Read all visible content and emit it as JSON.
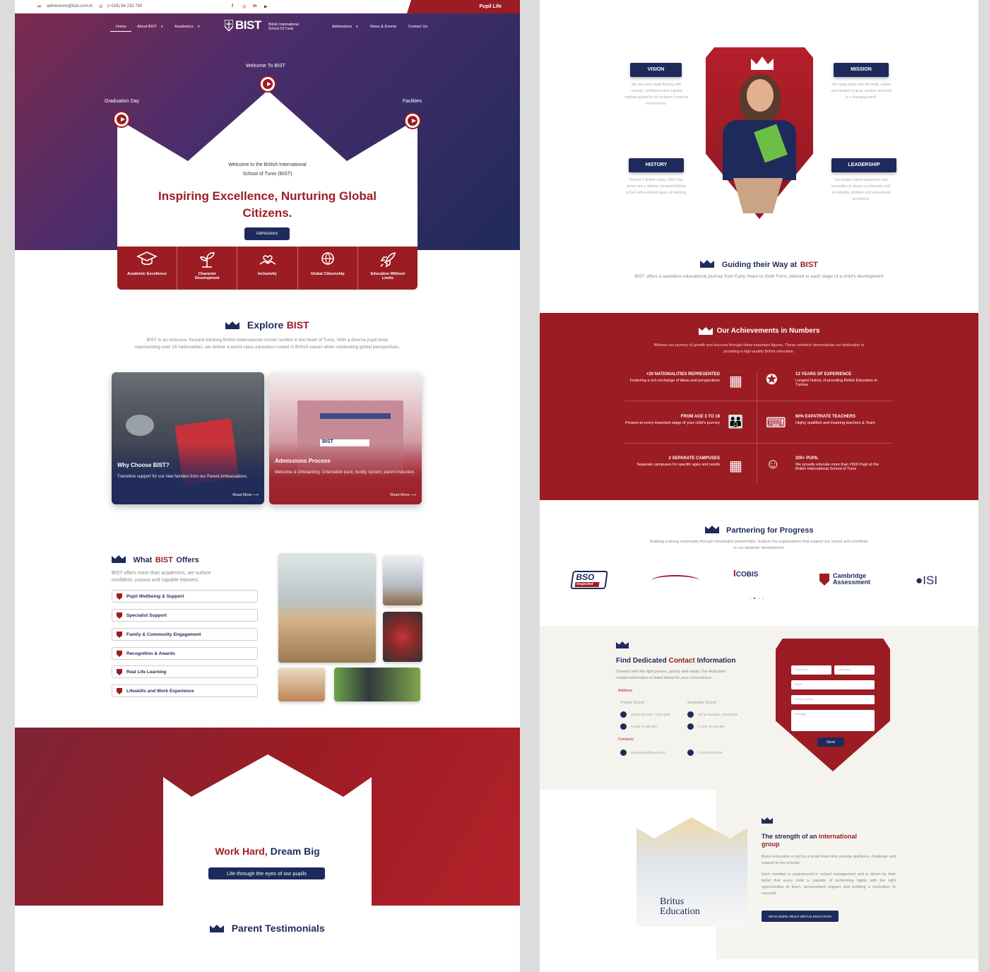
{
  "topbar": {
    "email": "admissions@bist.com.tn",
    "phone": "(+216) 94 232 730",
    "pupil_life": "Pupil Life"
  },
  "nav": {
    "home": "Home",
    "about": "About BIST",
    "academics": "Academics",
    "admissions": "Admissions",
    "news": "News & Events",
    "contact": "Contact Us"
  },
  "logo": {
    "name": "BIST",
    "line1": "British International",
    "line2": "School Of Tunis"
  },
  "hero": {
    "label_center": "Welcome To BIST",
    "label_left": "Graduation Day",
    "label_right": "Facilities",
    "welcome1": "Welcome to the British International",
    "welcome2": "School of Tunis (BIST)",
    "headline1": "Inspiring Excellence, Nurturing Global",
    "headline2": "Citizens.",
    "cta": "Admissions"
  },
  "features": [
    {
      "l1": "Academic Excellence",
      "l2": ""
    },
    {
      "l1": "Character",
      "l2": "Development"
    },
    {
      "l1": "Inclusivity",
      "l2": ""
    },
    {
      "l1": "Global Citizenship",
      "l2": ""
    },
    {
      "l1": "Education Without",
      "l2": "Limits"
    }
  ],
  "explore": {
    "title_a": "Explore",
    "title_b": "BIST",
    "p1": "BIST is an inclusive, forward-thinking British international school nestled in the heart of Tunis. With a diverse pupil body",
    "p2": "representing over 19 nationalities, we deliver a world-class education rooted in British values while celebrating global perspectives."
  },
  "cards": [
    {
      "title": "Why Choose BIST?",
      "desc": "Transition support for our new families from our Parent Ambassadors.",
      "more": "Read More"
    },
    {
      "title": "Admissions Process",
      "desc": "Welcome & Onboarding: Orientation pack, buddy system, parent induction.",
      "more": "Read More"
    }
  ],
  "offers": {
    "title_a": "What",
    "title_b": "BIST",
    "title_c": "Offers",
    "p1": "BIST offers more than academics, we nurture",
    "p2": "confident, curious and capable learners.",
    "items": [
      "Pupil Wellbeing & Support",
      "Specialist Support",
      "Family & Community Engagement",
      "Recognition & Awards",
      "Real Life Learning",
      "Lifeskills and Work Experience"
    ]
  },
  "banner": {
    "title_a": "Work Hard,",
    "title_b": "Dream Big",
    "button": "Life through the eyes of our pupils"
  },
  "testimonials": {
    "title": "Parent Testimonials"
  },
  "values": {
    "vision": {
      "label": "VISION",
      "text": "We see every pupil thriving with curiosity, confidence and a global mindset guided by an inclusive, inspiring environment."
    },
    "mission": {
      "label": "MISSION",
      "text": "We equip pupils with the skills, values and mindset to grow, achieve and lead in a changing world."
    },
    "history": {
      "label": "HISTORY",
      "text": "Rooted in British values, BIST has grown into a diverse, forward-thinking school with a strong legacy of learning."
    },
    "leadership": {
      "label": "LEADERSHIP",
      "text": "Our leaders blend experience and innovation to shape a community built on integrity, ambition and educational excellence."
    }
  },
  "guiding": {
    "title_a": "Guiding their Way at",
    "title_b": "BIST",
    "text": "BIST offers a seamless educational journey from Early Years to Sixth Form, tailored to each stage of a child's development"
  },
  "achievements": {
    "title": "Our Achievements in Numbers",
    "p1": "Witness our journey of growth and success through these important figures. These numbers demonstrate our dedication to",
    "p2": "providing a high-quality British education.",
    "items": [
      {
        "head": "+20 NATIONALITIES REPRESENTED",
        "text": "Fostering a rich exchange of ideas and perspectives"
      },
      {
        "head": "13 YEARS OF EXPERIENCE",
        "text": "Longest history of providing British Education in Tunisia"
      },
      {
        "head": "FROM AGE 3 TO 18",
        "text": "Present at every important stage of your child's journey"
      },
      {
        "head": "60% EXPATRIATE TEACHERS",
        "text": "Highly qualified and inspiring teachers & Team"
      },
      {
        "head": "2 SEPARATE CAMPUSES",
        "text": "Separate campuses for specific ages and needs"
      },
      {
        "head": "200+ PUPIL",
        "text": "We proudly educate more than 2500 Pupil at the British International School of Tunis"
      }
    ]
  },
  "partners": {
    "title": "Partnering for Progress",
    "p1": "Building a strong community through meaningful partnerships. Explore the organizations that support our school and contribute",
    "p2": "to our students' development.",
    "logos": [
      "BSO",
      "Inspected",
      "COBIS",
      "Cambridge",
      "Assessment",
      "ISI"
    ]
  },
  "contact": {
    "title_a": "Find Dedicated",
    "title_b": "Contact",
    "title_c": "Information",
    "p1": "Connect with the right person, quickly and easily. Our dedicated",
    "p2": "contact information is listed below for your convenience.",
    "address_label": "Address",
    "primary": "Primary School",
    "secondary": "Secondary School",
    "addr1": "48 Rue du Parc, Tunis 2035",
    "addr2": "42 rue Socrates, 2015 Kram",
    "tel1": "(+216) 70 240 680",
    "tel2": "(+216) 70 240 680",
    "contacts_label": "Contacts",
    "email": "admissions@bist.com.tn",
    "mobile": "(+216) 94232730",
    "form": {
      "first": "First name",
      "last": "Last name",
      "email": "Email",
      "phone": "Phone number",
      "message": "Message",
      "send": "Send"
    }
  },
  "britus": {
    "title_a": "The strength of an",
    "title_b": "international",
    "title_c": "group",
    "p1": "Britus Education is led by a small team who provide guidance, challenge and support to the schools.",
    "p2": "Each member is experienced in school management and is driven by their belief that every child is capable of performing highly with the right opportunities to learn, personalised support and instilling a motivation to succeed.",
    "button": "READ MORE ABOUT BRITUS EDUCATION",
    "logo1": "Britus",
    "logo2": "Education"
  }
}
